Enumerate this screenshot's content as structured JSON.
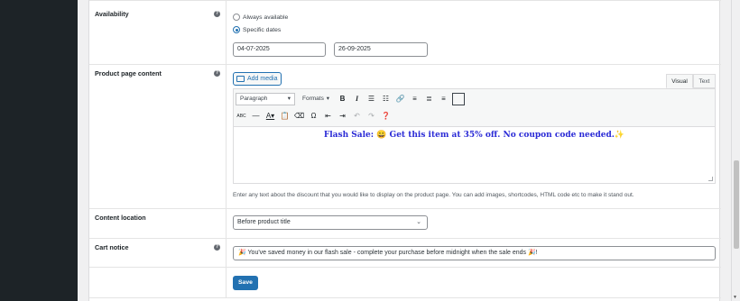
{
  "availability": {
    "label": "Availability",
    "options": [
      "Always available",
      "Specific dates"
    ],
    "selected": "Specific dates",
    "start_date": "04-07-2025",
    "end_date": "26-09-2025"
  },
  "product_page_content": {
    "label": "Product page content",
    "add_media": "Add media",
    "tabs": [
      "Visual",
      "Text"
    ],
    "active_tab": "Visual",
    "format_select": "Paragraph",
    "formats_menu": "Formats",
    "content": "Flash Sale: 😀 Get this item at 35% off. No coupon code needed.✨",
    "description": "Enter any text about the discount that you would like to display on the product page. You can add images, shortcodes, HTML code etc to make it stand out."
  },
  "content_location": {
    "label": "Content location",
    "value": "Before product title"
  },
  "cart_notice": {
    "label": "Cart notice",
    "value": "🎉 You've saved money in our flash sale - complete your purchase before midnight when the sale ends 🎉!"
  },
  "save_button": "Save",
  "toolbar_icons": [
    "bold-icon",
    "italic-icon",
    "bulleted-list-icon",
    "numbered-list-icon",
    "link-icon",
    "align-left-icon",
    "align-center-icon",
    "align-right-icon",
    "fullscreen-icon",
    "strikethrough-icon",
    "horizontal-line-icon",
    "text-color-icon",
    "paste-text-icon",
    "clear-formatting-icon",
    "special-character-icon",
    "outdent-icon",
    "indent-icon",
    "undo-icon",
    "redo-icon",
    "help-icon"
  ]
}
